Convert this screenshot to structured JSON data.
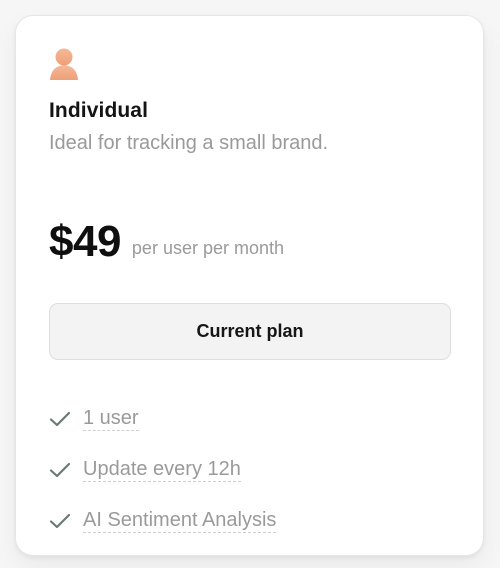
{
  "plan": {
    "name": "Individual",
    "description": "Ideal for tracking a small brand.",
    "price": "$49",
    "period": "per user per month",
    "button_label": "Current plan"
  },
  "features": [
    {
      "label": "1 user",
      "icon": "check-icon"
    },
    {
      "label": "Update every 12h",
      "icon": "check-icon"
    },
    {
      "label": "AI Sentiment Analysis",
      "icon": "check-icon"
    }
  ],
  "colors": {
    "accent_check": "#6b7b72",
    "avatar": "#f0b08c",
    "muted_text": "#9a9a9a",
    "button_bg": "#f3f3f3"
  },
  "icons": {
    "plan_icon": "user-avatar-icon"
  }
}
